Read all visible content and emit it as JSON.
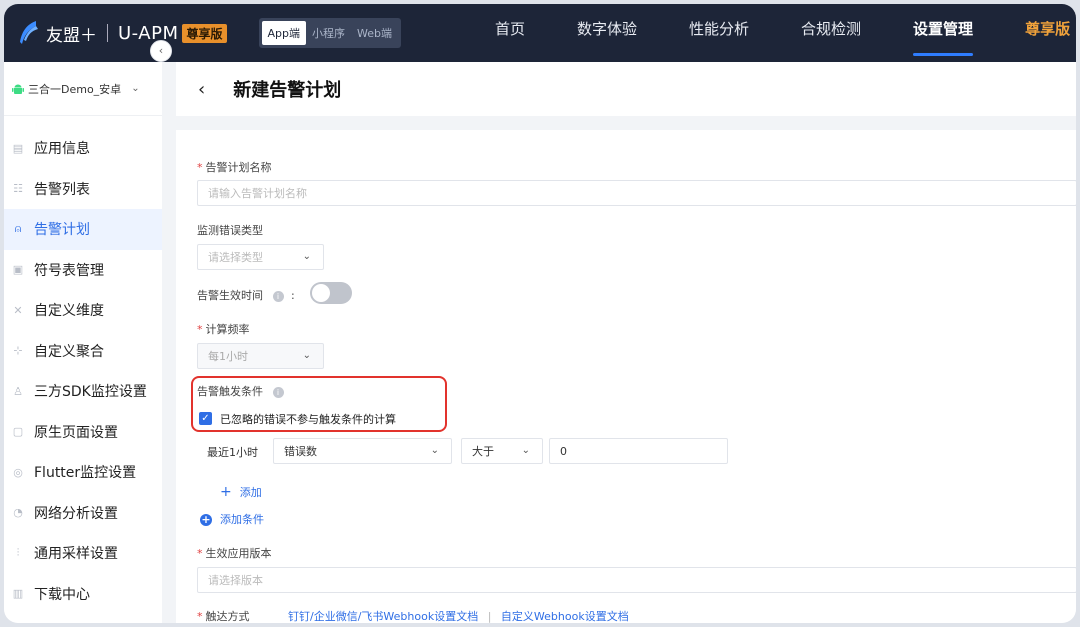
{
  "header": {
    "logo_text": "友盟＋",
    "product": "U-APM",
    "vip_badge": "尊享版",
    "platform_tabs": [
      "App端",
      "小程序",
      "Web端"
    ],
    "active_platform": "App端",
    "nav": [
      "首页",
      "数字体验",
      "性能分析",
      "合规检测",
      "设置管理",
      "尊享版"
    ],
    "active_nav": "设置管理"
  },
  "sidebar": {
    "app_name": "三合一Demo_安卓",
    "items": [
      {
        "label": "应用信息",
        "icon": "doc-icon"
      },
      {
        "label": "告警列表",
        "icon": "list-icon"
      },
      {
        "label": "告警计划",
        "icon": "alarm-icon"
      },
      {
        "label": "符号表管理",
        "icon": "symbol-icon"
      },
      {
        "label": "自定义维度",
        "icon": "dimension-icon"
      },
      {
        "label": "自定义聚合",
        "icon": "aggregate-icon"
      },
      {
        "label": "三方SDK监控设置",
        "icon": "user-icon"
      },
      {
        "label": "原生页面设置",
        "icon": "page-icon"
      },
      {
        "label": "Flutter监控设置",
        "icon": "flutter-icon"
      },
      {
        "label": "网络分析设置",
        "icon": "network-icon"
      },
      {
        "label": "通用采样设置",
        "icon": "sample-icon"
      },
      {
        "label": "下载中心",
        "icon": "download-icon"
      }
    ],
    "active_index": 2
  },
  "page": {
    "title": "新建告警计划"
  },
  "form": {
    "plan_name_label": "告警计划名称",
    "plan_name_placeholder": "请输入告警计划名称",
    "error_type_label": "监测错误类型",
    "error_type_placeholder": "请选择类型",
    "effective_time_label": "告警生效时间",
    "effective_time_colon": ":",
    "frequency_label": "计算频率",
    "frequency_value": "每1小时",
    "trigger_label": "告警触发条件",
    "ignore_checkbox_label": "已忽略的错误不参与触发条件的计算",
    "condition": {
      "period": "最近1小时",
      "metric": "错误数",
      "operator": "大于",
      "threshold": "0"
    },
    "add_label": "添加",
    "add_condition_label": "添加条件",
    "version_label": "生效应用版本",
    "version_placeholder": "请选择版本",
    "delivery_label": "触达方式",
    "doc_link_1": "钉钉/企业微信/飞书Webhook设置文档",
    "link_sep": "|",
    "doc_link_2": "自定义Webhook设置文档"
  },
  "colors": {
    "nav_bg": "#1d2538",
    "accent": "#2f6ee5",
    "vip": "#f0a23b",
    "highlight": "#e2332d"
  }
}
